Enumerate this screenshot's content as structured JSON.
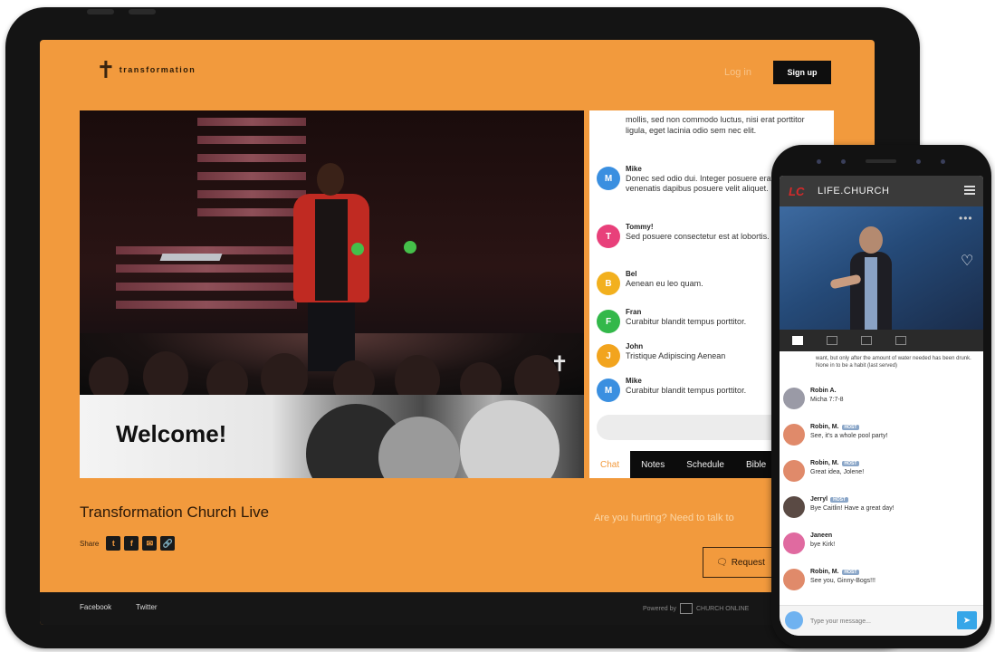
{
  "tablet": {
    "logo_text": "transformation",
    "login_label": "Log in",
    "signup_label": "Sign up",
    "video": {
      "overlay_icon": "cross-icon"
    },
    "welcome_text": "Welcome!",
    "chat": {
      "lead_text": "mollis, sed non commodo luctus, nisi erat porttitor ligula, eget lacinia odio sem nec elit.",
      "messages": [
        {
          "initial": "M",
          "name": "Mike",
          "text": "Donec sed odio dui. Integer posuere erat a ante venenatis dapibus posuere velit aliquet.",
          "color": "#3a8fe0"
        },
        {
          "initial": "T",
          "name": "Tommy!",
          "text": "Sed posuere consectetur est at lobortis.",
          "color": "#e8407a"
        },
        {
          "initial": "B",
          "name": "Bel",
          "text": "Aenean eu leo quam.",
          "color": "#f2b01e"
        },
        {
          "initial": "F",
          "name": "Fran",
          "text": "Curabitur blandit tempus porttitor.",
          "color": "#33b84a"
        },
        {
          "initial": "J",
          "name": "John",
          "text": "Tristique Adipiscing Aenean",
          "color": "#f2a41e"
        },
        {
          "initial": "M",
          "name": "Mike",
          "text": "Curabitur blandit tempus porttitor.",
          "color": "#3a8fe0"
        }
      ],
      "tabs": [
        {
          "label": "Chat",
          "active": true
        },
        {
          "label": "Notes",
          "active": false
        },
        {
          "label": "Schedule",
          "active": false
        },
        {
          "label": "Bible",
          "active": false
        }
      ]
    },
    "stream_title": "Transformation Church Live",
    "share_label": "Share",
    "share_icons": [
      "twitter-icon",
      "facebook-icon",
      "email-icon",
      "link-icon"
    ],
    "prayer_text": "Are you hurting? Need to talk to",
    "request_button_label": "Request",
    "footer": {
      "links": [
        "Facebook",
        "Twitter"
      ],
      "powered_by": "Powered by",
      "powered_name": "CHURCH ONLINE"
    },
    "accent_color": "#f29a3d"
  },
  "phone": {
    "brand": "LIFE.CHURCH",
    "logo_mark": "LC",
    "lead_text": "want, but only after the amount of water needed has been drunk. None in to be a habit (last served)",
    "messages": [
      {
        "name": "Robin A.",
        "badge": "",
        "text": "Micha 7:7-8",
        "avatar_color": "#9a9aa6"
      },
      {
        "name": "Robin, M.",
        "badge": "HOST",
        "text": "See, it's a whole pool party!",
        "avatar_color": "#e08a6a"
      },
      {
        "name": "Robin, M.",
        "badge": "HOST",
        "text": "Great idea, Jolene!",
        "avatar_color": "#e08a6a"
      },
      {
        "name": "Jerryl",
        "badge": "HOST",
        "text": "Bye Caitlin! Have a great day!",
        "avatar_color": "#5a4a44"
      },
      {
        "name": "Janeen",
        "badge": "",
        "text": "bye Kirk!",
        "avatar_color": "#e06aa0"
      },
      {
        "name": "Robin, M.",
        "badge": "HOST",
        "text": "See you, Ginny-Bogs!!!",
        "avatar_color": "#e08a6a"
      }
    ],
    "input_placeholder": "Type your message...",
    "send_icon": "send-icon"
  }
}
